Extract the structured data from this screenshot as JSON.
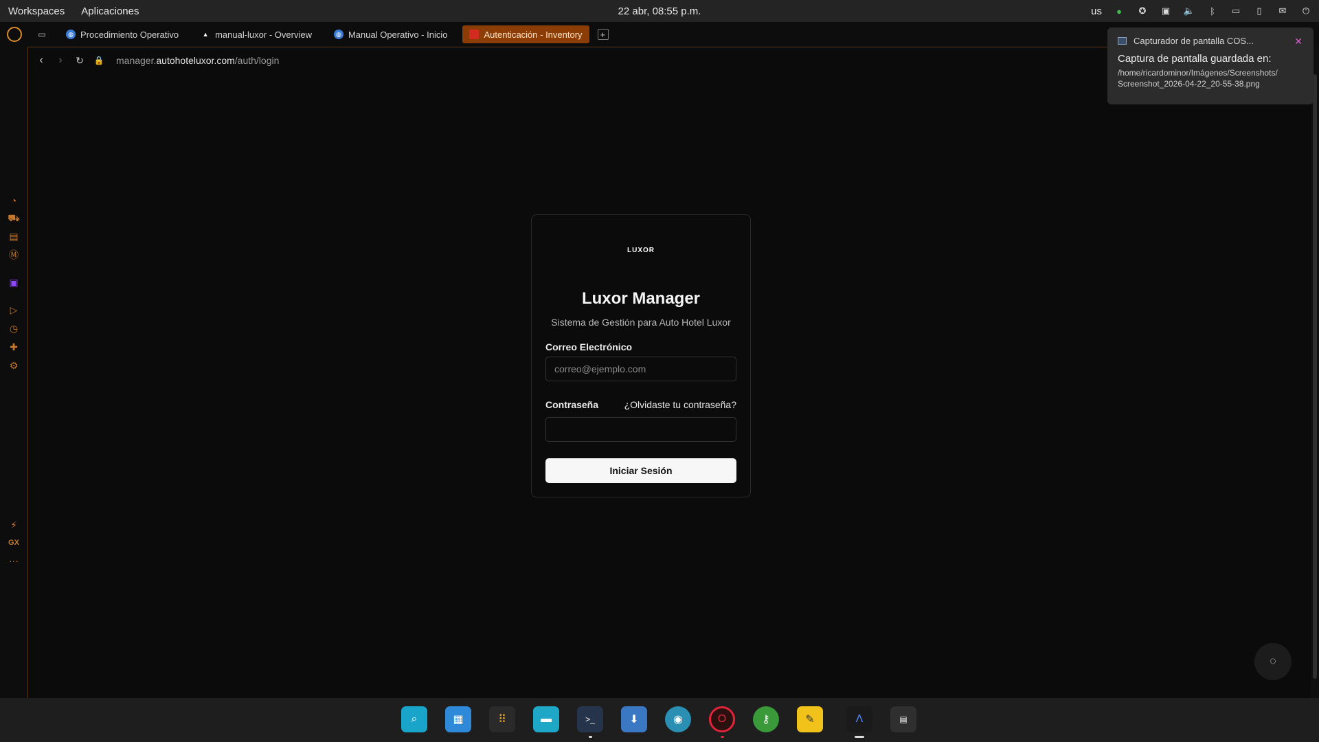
{
  "topbar": {
    "menu": [
      "Workspaces",
      "Aplicaciones"
    ],
    "clock": "22 abr, 08:55 p.m.",
    "keyboard_layout": "us",
    "tray_icons": [
      "chat-icon",
      "accessibility-icon",
      "display-icon",
      "volume-icon",
      "bluetooth-icon",
      "screenshot-icon",
      "battery-icon",
      "notifications-icon",
      "power-icon"
    ]
  },
  "tabs": [
    {
      "label": "Procedimiento Operativo",
      "favicon": "globe",
      "active": false
    },
    {
      "label": "manual-luxor - Overview",
      "favicon": "triangle",
      "active": false
    },
    {
      "label": "Manual Operativo - Inicio",
      "favicon": "globe",
      "active": false
    },
    {
      "label": "Autenticación - Inventory",
      "favicon": "red",
      "active": true
    }
  ],
  "address": {
    "prefix": "manager.",
    "domain": "autohoteluxor.com",
    "path": "/auth/login"
  },
  "login": {
    "logo": "LUXOR",
    "title": "Luxor Manager",
    "subtitle": "Sistema de Gestión para Auto Hotel Luxor",
    "email_label": "Correo Electrónico",
    "email_placeholder": "correo@ejemplo.com",
    "password_label": "Contraseña",
    "forgot_link": "¿Olvidaste tu contraseña?",
    "submit_label": "Iniciar Sesión"
  },
  "notification": {
    "app": "Capturador de pantalla COS...",
    "message": "Captura de pantalla guardada en:",
    "path_line1": "/home/ricardominor/Imágenes/Screenshots/",
    "path_line2": "Screenshot_2026-04-22_20-55-38.png"
  },
  "sidebar": {
    "gx_label": "GX",
    "more_label": "···"
  },
  "colors": {
    "accent": "#c8782a",
    "active_tab": "#8c3d06"
  }
}
